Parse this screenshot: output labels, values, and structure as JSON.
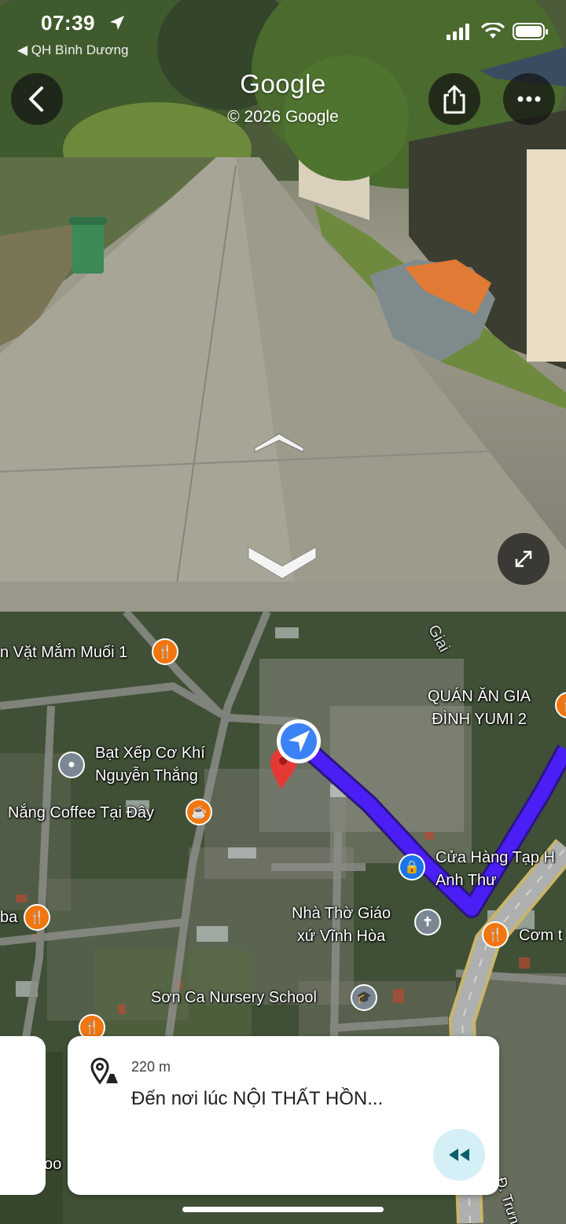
{
  "status_bar": {
    "time": "07:39",
    "back_app": "QH Bình Dương"
  },
  "street_view": {
    "title": "Google",
    "copyright": "© 2026 Google",
    "buttons": {
      "back": "back-icon",
      "share": "share-icon",
      "more": "more-icon",
      "expand": "expand-icon"
    }
  },
  "map": {
    "places": [
      {
        "name": "n Vặt Mắm Muối 1",
        "type": "food"
      },
      {
        "name": "QUÁN ĂN GIA\nĐÌNH YUMI 2",
        "type": "food"
      },
      {
        "name": "Bạt Xếp Cơ Khí\nNguyễn Thắng",
        "type": "gray"
      },
      {
        "name": "Nắng Coffee Tại Đây",
        "type": "cafe"
      },
      {
        "name": "Cửa Hàng Tạp H\nAnh Thư",
        "type": "shop"
      },
      {
        "name": "Nhà Thờ Giáo\nxứ Vĩnh Hòa",
        "type": "church"
      },
      {
        "name": "Cơm t",
        "type": "food"
      },
      {
        "name": "Sơn Ca Nursery School",
        "type": "school"
      },
      {
        "name": "ba",
        "type": "food"
      },
      {
        "name": "Giai",
        "type": "road"
      },
      {
        "name": "Đ. Trưng",
        "type": "road"
      },
      {
        "name": "oo",
        "type": "partial"
      }
    ]
  },
  "navigation_card": {
    "distance": "220 m",
    "destination": "Đến nơi lúc NỘI THẤT HỒN...",
    "rewind_icon": "rewind-icon",
    "location_icon": "location-pin-icon"
  },
  "colors": {
    "route": "#4a1ef5",
    "food_pin": "#f2760f",
    "shop_pin": "#1a73e8",
    "destination_pin": "#e53935",
    "nav_dot": "#3b82f6"
  }
}
